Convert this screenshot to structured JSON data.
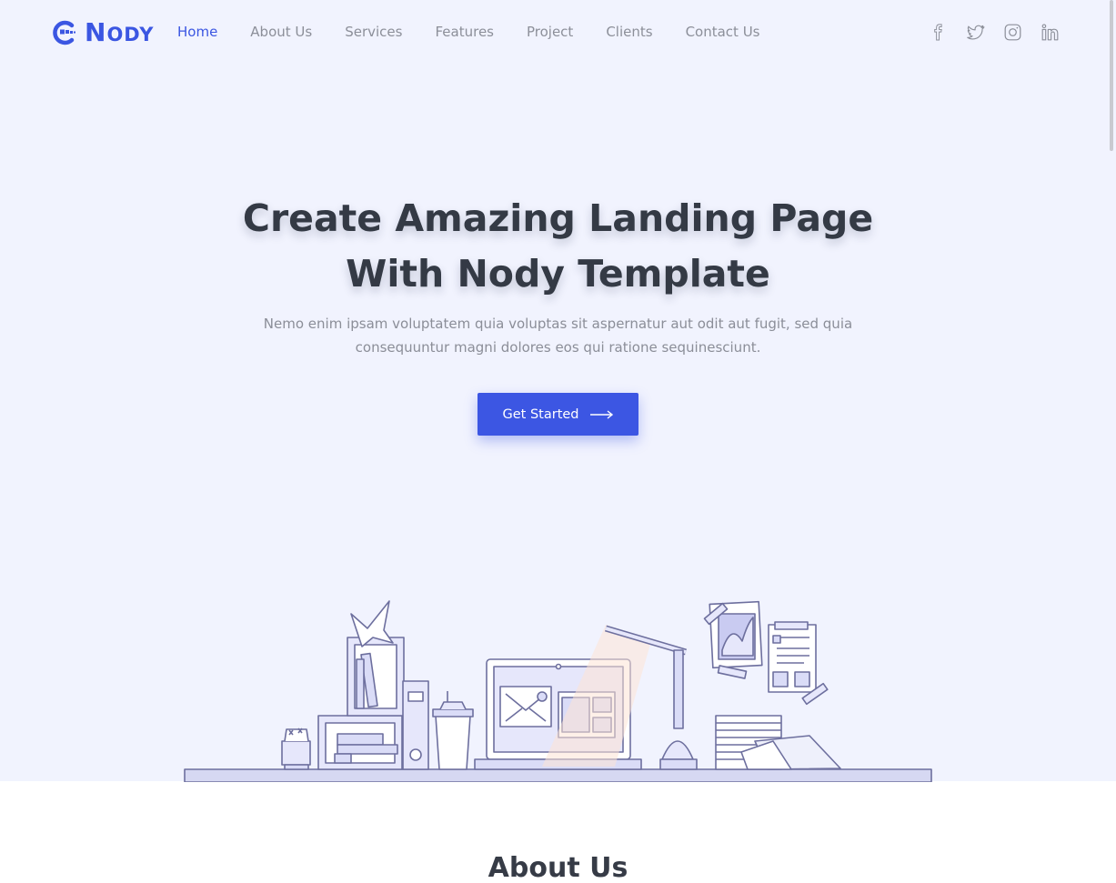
{
  "brand": {
    "name_first": "N",
    "name_rest": "ODY",
    "logo_icon": "nody-logo-icon",
    "accent": "#3b56e2"
  },
  "nav": {
    "items": [
      {
        "label": "Home",
        "active": true
      },
      {
        "label": "About Us"
      },
      {
        "label": "Services"
      },
      {
        "label": "Features"
      },
      {
        "label": "Project"
      },
      {
        "label": "Clients"
      },
      {
        "label": "Contact Us"
      }
    ]
  },
  "social": [
    "facebook-icon",
    "twitter-icon",
    "instagram-icon",
    "linkedin-icon"
  ],
  "hero": {
    "title_line1": "Create Amazing Landing Page",
    "title_line2": "With Nody Template",
    "subtitle_line1": "Nemo enim ipsam voluptatem quia voluptas sit aspernatur aut odit aut fugit, sed quia",
    "subtitle_line2": "consequuntur magni dolores eos qui ratione sequinesciunt.",
    "cta_label": "Get Started",
    "cta_icon": "arrow-right-icon",
    "background": "#f1f3fe"
  },
  "about": {
    "title": "About Us"
  }
}
